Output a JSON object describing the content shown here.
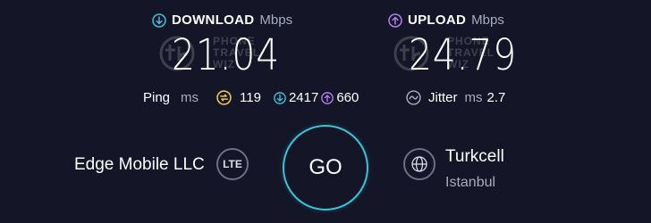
{
  "download": {
    "label": "DOWNLOAD",
    "unit": "Mbps",
    "value": "21.04",
    "icon": "download-arrow-icon",
    "color": "#3bc3d8"
  },
  "upload": {
    "label": "UPLOAD",
    "unit": "Mbps",
    "value": "24.79",
    "icon": "upload-arrow-icon",
    "color": "#b37ff0"
  },
  "watermark": {
    "line1": "PHONE",
    "line2": "TRAVEL",
    "line3": "WIZ"
  },
  "ping": {
    "label": "Ping",
    "unit": "ms",
    "idle": "119",
    "download": "2417",
    "upload": "660",
    "idle_color": "#e9c84a"
  },
  "jitter": {
    "label": "Jitter",
    "unit": "ms",
    "value": "2.7"
  },
  "provider": {
    "name": "Edge Mobile LLC",
    "badge": "LTE"
  },
  "go_button": {
    "label": "GO",
    "color": "#3bc3d8"
  },
  "server": {
    "name": "Turkcell",
    "location": "Istanbul",
    "icon": "globe-icon"
  }
}
